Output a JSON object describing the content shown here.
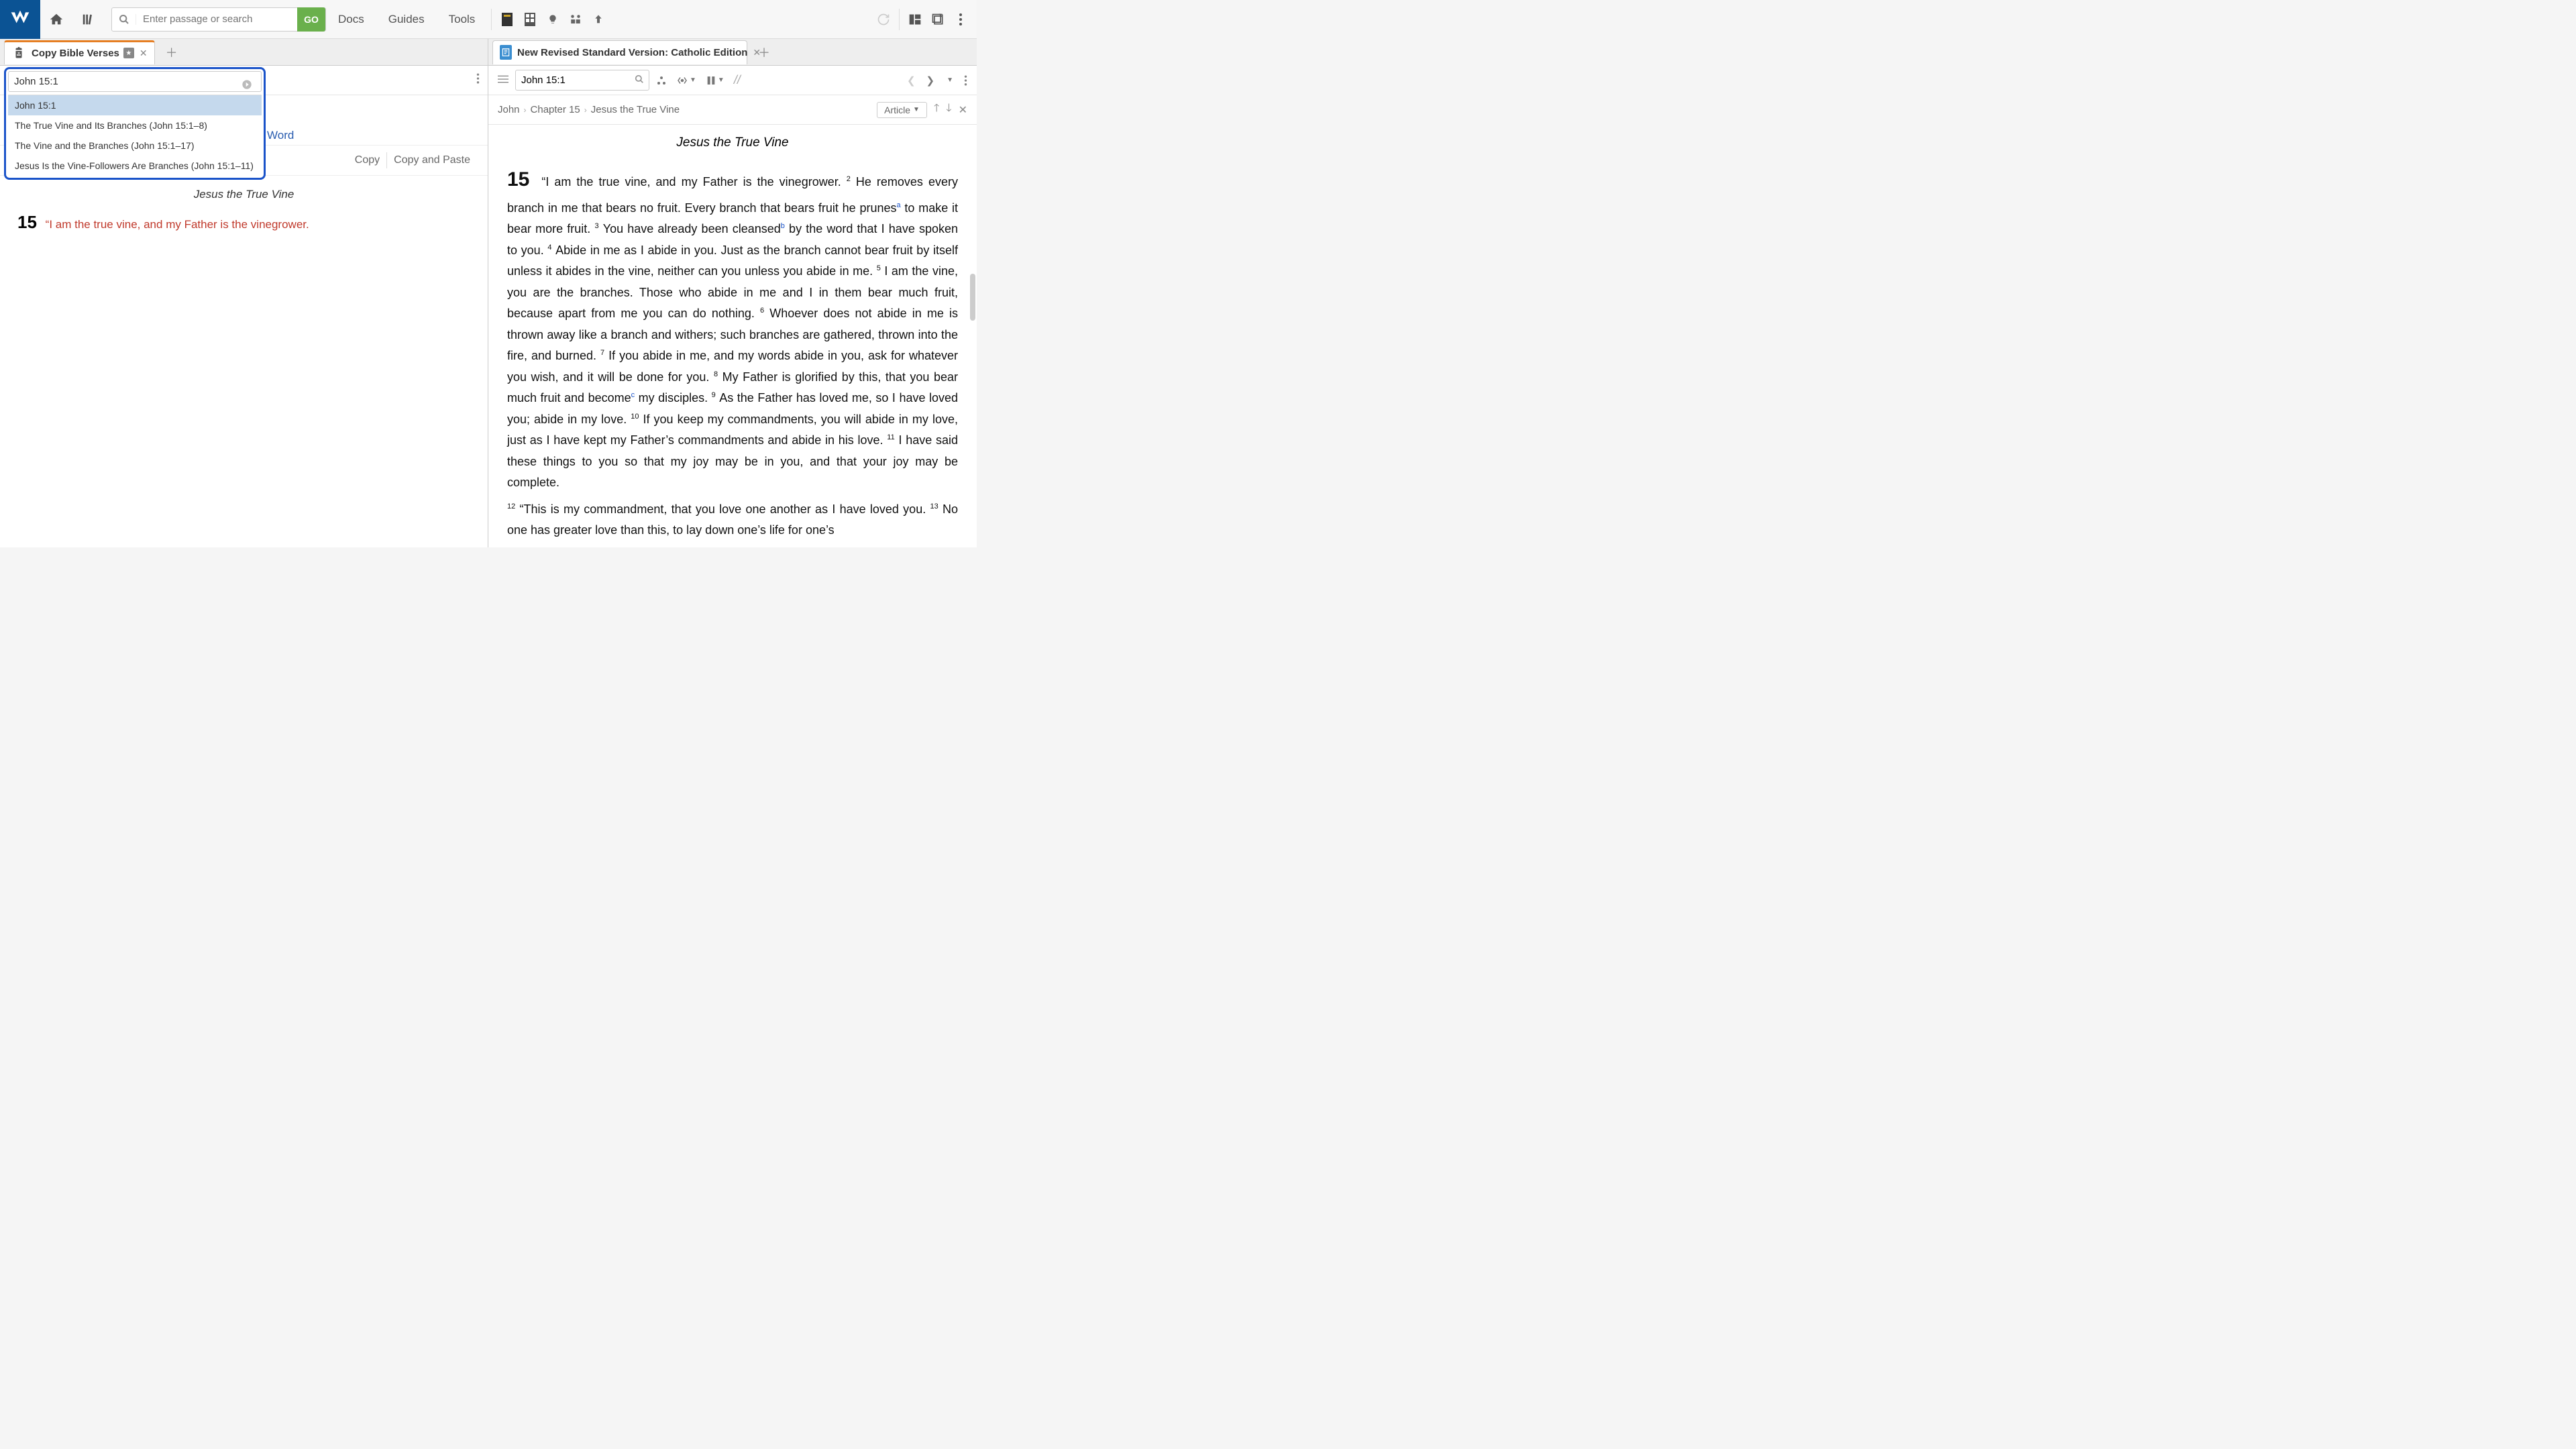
{
  "topbar": {
    "search_placeholder": "Enter passage or search",
    "go_label": "GO",
    "nav": {
      "docs": "Docs",
      "guides": "Guides",
      "tools": "Tools"
    }
  },
  "left_pane": {
    "tab_label": "Copy Bible Verses",
    "ref_value": "John 15:1",
    "suggestions": [
      "John 15:1",
      "The True Vine and Its Branches (John 15:1–8)",
      "The Vine and the Branches (John 15:1–17)",
      "Jesus Is the Vine-Followers Are Branches (John 15:1–11)"
    ],
    "sub_format_partial": "Word",
    "copy_btn": "Copy",
    "copy_paste_btn": "Copy and Paste",
    "passage_title": "Jesus the True Vine",
    "chapter_num": "15",
    "verse_text": "“I am the true vine, and my Father is the vinegrower."
  },
  "right_pane": {
    "tab_label": "New Revised Standard Version: Catholic Edition",
    "ref_value": "John 15:1",
    "breadcrumb": {
      "book": "John",
      "chapter": "Chapter 15",
      "section": "Jesus the True Vine"
    },
    "article_label": "Article",
    "title": "Jesus the True Vine",
    "chapter_num": "15",
    "body_html": "“I am the true vine, and my Father is the vinegrower. <sup>2</sup> He removes every branch in me that bears no fruit. Every branch that bears fruit he prunes<sup class='fn'>a</sup> to make it bear more fruit. <sup>3</sup> You have already been cleansed<sup class='fn'>b</sup> by the word that I have spoken to you. <sup>4</sup> Abide in me as I abide in you. Just as the branch cannot bear fruit by itself unless it abides in the vine, neither can you unless you abide in me. <sup>5</sup> I am the vine, you are the branches. Those who abide in me and I in them bear much fruit, because apart from me you can do nothing. <sup>6</sup> Whoever does not abide in me is thrown away like a branch and withers; such branches are gathered, thrown into the fire, and burned. <sup>7</sup> If you abide in me, and my words abide in you, ask for whatever you wish, and it will be done for you. <sup>8</sup> My Father is glorified by this, that you bear much fruit and become<sup class='fn'>c</sup> my disciples. <sup>9</sup> As the Father has loved me, so I have loved you; abide in my love. <sup>10</sup> If you keep my commandments, you will abide in my love, just as I have kept my Father’s commandments and abide in his love. <sup>11</sup> I have said these things to you so that my joy may be in you, and that your joy may be complete.",
    "body2_html": "<sup>12</sup> “This is my commandment, that you love one another as I have loved you. <sup>13</sup> No one has greater love than this, to lay down one’s life for one’s"
  }
}
